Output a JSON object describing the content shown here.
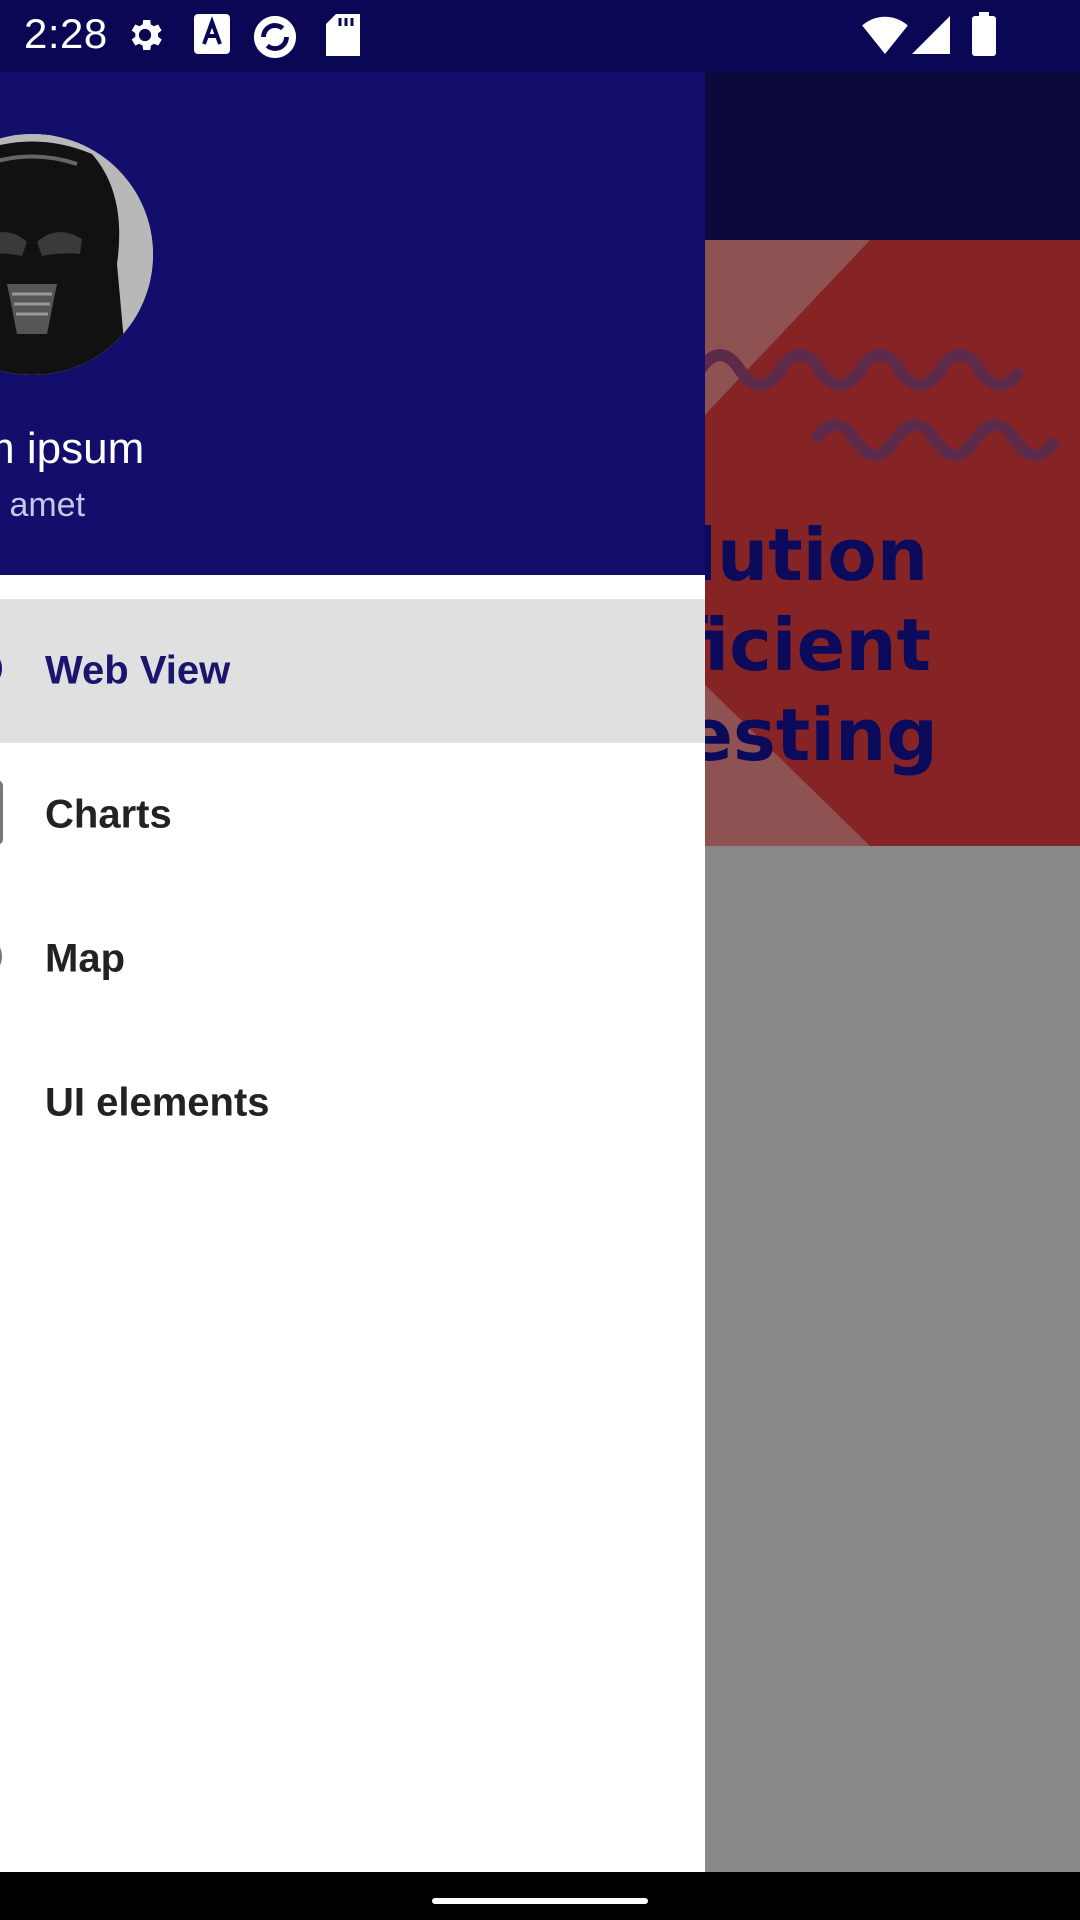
{
  "status_bar": {
    "time": "2:28",
    "left_icons": [
      "gear-icon",
      "text-a-icon",
      "sync-app-icon",
      "sd-card-icon"
    ],
    "right_icons": [
      "wifi-icon",
      "cellular-signal-icon",
      "battery-icon"
    ]
  },
  "background_app": {
    "banner_lines": [
      "solution",
      "efficient",
      "l testing"
    ],
    "colors": {
      "toolbar": "#0c0a3b",
      "banner": "#862425",
      "banner_text": "#0c0a5a"
    }
  },
  "drawer": {
    "header": {
      "avatar_icon": "darth-vader-avatar",
      "name": "m ipsum",
      "subtitle": "sit amet",
      "background": "#130d6b"
    },
    "items": [
      {
        "label": "Web View",
        "icon": "globe-icon",
        "selected": true
      },
      {
        "label": "Charts",
        "icon": "chart-icon",
        "selected": false
      },
      {
        "label": "Map",
        "icon": "map-icon",
        "selected": false
      },
      {
        "label": "UI elements",
        "icon": "",
        "selected": false
      }
    ]
  }
}
